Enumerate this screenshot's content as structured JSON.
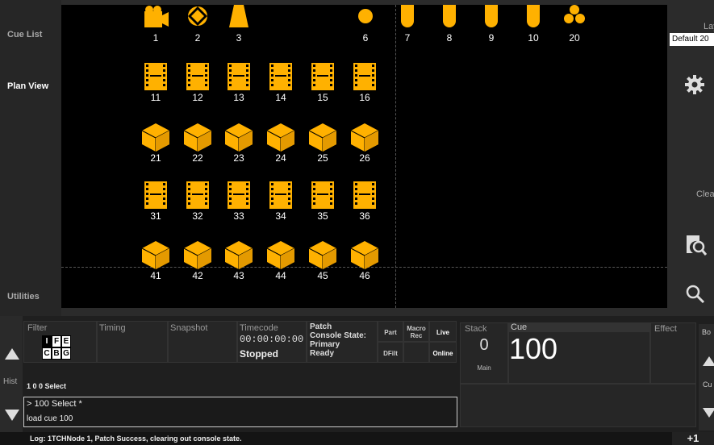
{
  "nav": {
    "cue_list": "Cue List",
    "plan_view": "Plan View",
    "utilities": "Utilities"
  },
  "right": {
    "layout_label": "Layo",
    "layout_value": "Default 20",
    "clear_label": "Clea"
  },
  "fixtures_row1": [
    {
      "num": "1",
      "icon": "camera-icon"
    },
    {
      "num": "2",
      "icon": "circle-diamond-icon"
    },
    {
      "num": "3",
      "icon": "triangle-icon"
    },
    {
      "num": "6",
      "icon": "dot-icon"
    },
    {
      "num": "7",
      "icon": "pill-icon"
    },
    {
      "num": "8",
      "icon": "pill-icon"
    },
    {
      "num": "9",
      "icon": "pill-icon"
    },
    {
      "num": "10",
      "icon": "pill-icon"
    },
    {
      "num": "20",
      "icon": "cluster-icon"
    }
  ],
  "fixtures_film1": [
    "11",
    "12",
    "13",
    "14",
    "15",
    "16"
  ],
  "fixtures_cube1": [
    "21",
    "22",
    "23",
    "24",
    "25",
    "26"
  ],
  "fixtures_film2": [
    "31",
    "32",
    "33",
    "34",
    "35",
    "36"
  ],
  "fixtures_cube2": [
    "41",
    "42",
    "43",
    "44",
    "45",
    "46"
  ],
  "command": {
    "filter": "Filter",
    "timing": "Timing",
    "snapshot": "Snapshot",
    "timecode_label": "Timecode",
    "timecode_value": "00:00:00:00",
    "timecode_state": "Stopped",
    "patch_label": "Patch",
    "console_state_label": "Console State:",
    "console_state_value1": "Primary",
    "console_state_value2": "Ready",
    "part": "Part",
    "macro_rec": "Macro Rec",
    "live": "Live",
    "dfilt": "DFilt",
    "online": "Online",
    "filter_letters": [
      "I",
      "F",
      "E",
      "C",
      "B",
      "G"
    ],
    "hist": "Hist",
    "cmd_line": "1 0 0 Select",
    "history_line1": "> 100 Select *",
    "history_line2": "load cue 100"
  },
  "cue": {
    "stack_label": "Stack",
    "stack_value": "0",
    "stack_sub": "Main",
    "cue_label": "Cue",
    "cue_value": "100",
    "effect_label": "Effect",
    "right_bo": "Bo",
    "right_cu": "Cu"
  },
  "log": {
    "text": "Log: 1TCHNode 1, Patch Success, clearing out console state.",
    "plus": "+1"
  },
  "colors": {
    "fixture": "#ffb100",
    "bg": "#000000"
  }
}
